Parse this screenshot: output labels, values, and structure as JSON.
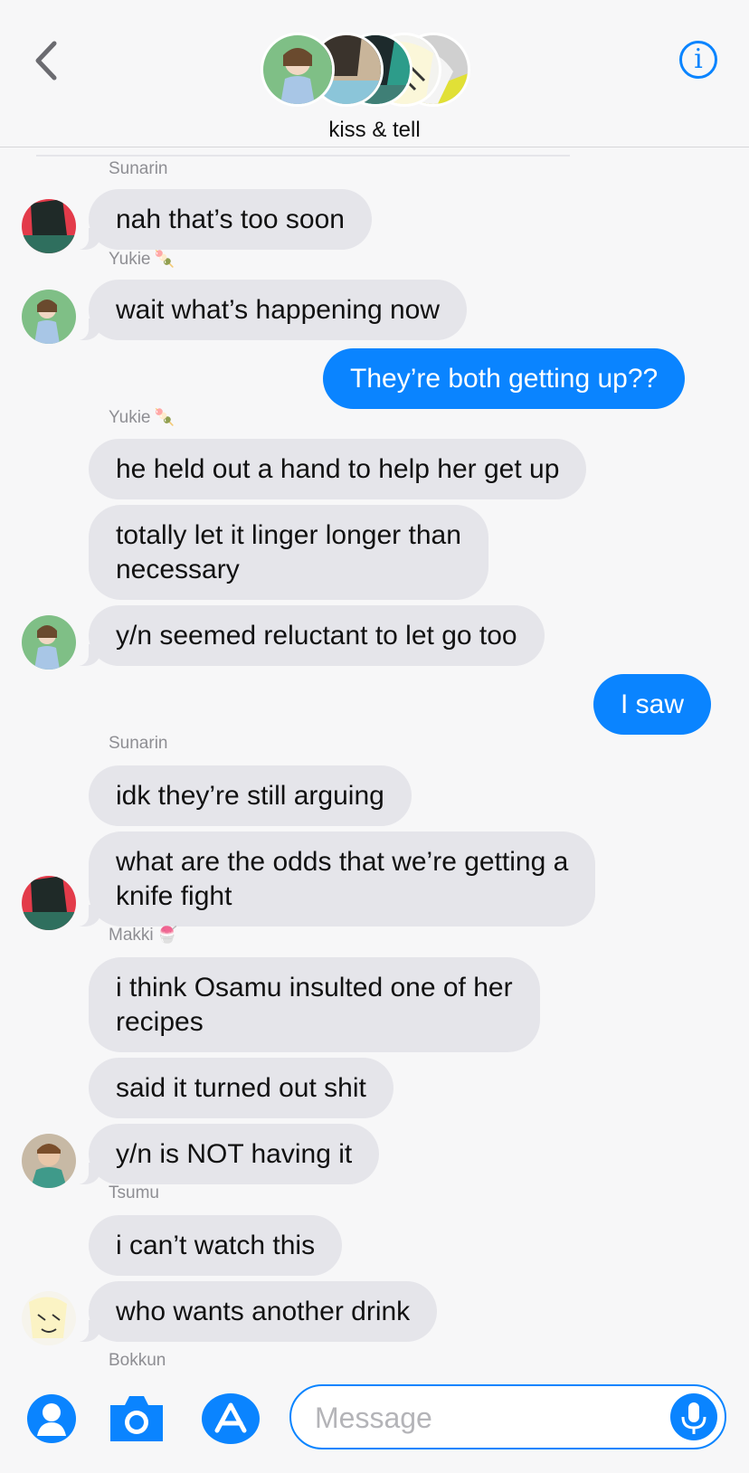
{
  "header": {
    "title": "kiss & tell"
  },
  "messages": [
    {
      "type": "sender",
      "name": "Sunarin",
      "emoji": ""
    },
    {
      "type": "in",
      "text": "nah that’s too soon"
    },
    {
      "type": "sender",
      "name": "Yukie",
      "emoji": "🍡"
    },
    {
      "type": "in",
      "text": "wait what’s happening now"
    },
    {
      "type": "out",
      "text": "They’re both getting up??"
    },
    {
      "type": "sender",
      "name": "Yukie",
      "emoji": "🍡"
    },
    {
      "type": "in",
      "text": "he held out a hand to help her get up"
    },
    {
      "type": "in",
      "lines": [
        "totally let it linger longer than",
        "necessary"
      ]
    },
    {
      "type": "in",
      "text": "y/n seemed reluctant to let go too"
    },
    {
      "type": "out",
      "text": "I saw"
    },
    {
      "type": "sender",
      "name": "Sunarin",
      "emoji": ""
    },
    {
      "type": "in",
      "text": "idk they’re still arguing"
    },
    {
      "type": "in",
      "lines": [
        "what are the odds that we’re getting a",
        "knife fight"
      ]
    },
    {
      "type": "sender",
      "name": "Makki",
      "emoji": "🍧"
    },
    {
      "type": "in",
      "lines": [
        "i think Osamu insulted one of her",
        "recipes"
      ]
    },
    {
      "type": "in",
      "text": "said it turned out shit"
    },
    {
      "type": "in",
      "text": "y/n is NOT having it"
    },
    {
      "type": "sender",
      "name": "Tsumu",
      "emoji": ""
    },
    {
      "type": "in",
      "text": "i can’t watch this"
    },
    {
      "type": "in",
      "text": "who wants another drink"
    },
    {
      "type": "sender",
      "name": "Bokkun",
      "emoji": ""
    }
  ],
  "composer": {
    "placeholder": "Message"
  },
  "icons": {
    "back": "chevron-left-icon",
    "info": "info-icon",
    "contacts": "person-icon",
    "camera": "camera-icon",
    "appstore": "app-store-icon",
    "mic": "microphone-icon"
  },
  "colors": {
    "accent": "#0a84ff",
    "incoming_bubble": "#e5e5ea",
    "background": "#f7f7f8"
  }
}
